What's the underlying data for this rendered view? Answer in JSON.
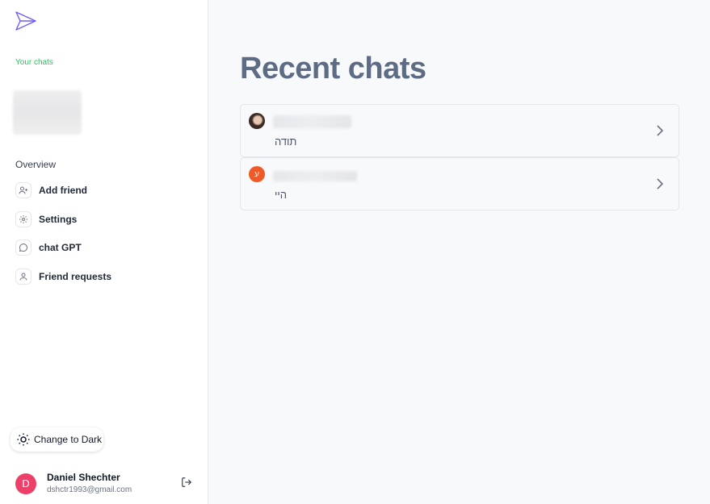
{
  "sidebar": {
    "logo_icon": "paper-plane-icon",
    "section_label": "Your chats",
    "overview_label": "Overview",
    "nav": [
      {
        "label": "Add friend",
        "icon": "user-plus-icon"
      },
      {
        "label": "Settings",
        "icon": "gear-icon"
      },
      {
        "label": "chat GPT",
        "icon": "message-circle-icon"
      },
      {
        "label": "Friend requests",
        "icon": "user-icon"
      }
    ],
    "theme_button": "Change to Dark",
    "user": {
      "initial": "D",
      "name": "Daniel Shechter",
      "email": "dshctr1993@gmail.com"
    }
  },
  "main": {
    "title": "Recent chats",
    "chats": [
      {
        "avatar_type": "photo",
        "message": "תודה"
      },
      {
        "avatar_type": "letter",
        "avatar_letter": "ע",
        "message": "היי"
      }
    ]
  },
  "colors": {
    "accent_green": "#22c55e",
    "logo": "#6d5dfc",
    "user_avatar": "#ec4068",
    "chat_avatar_letter": "#f05a28",
    "title": "#5d6c84"
  }
}
